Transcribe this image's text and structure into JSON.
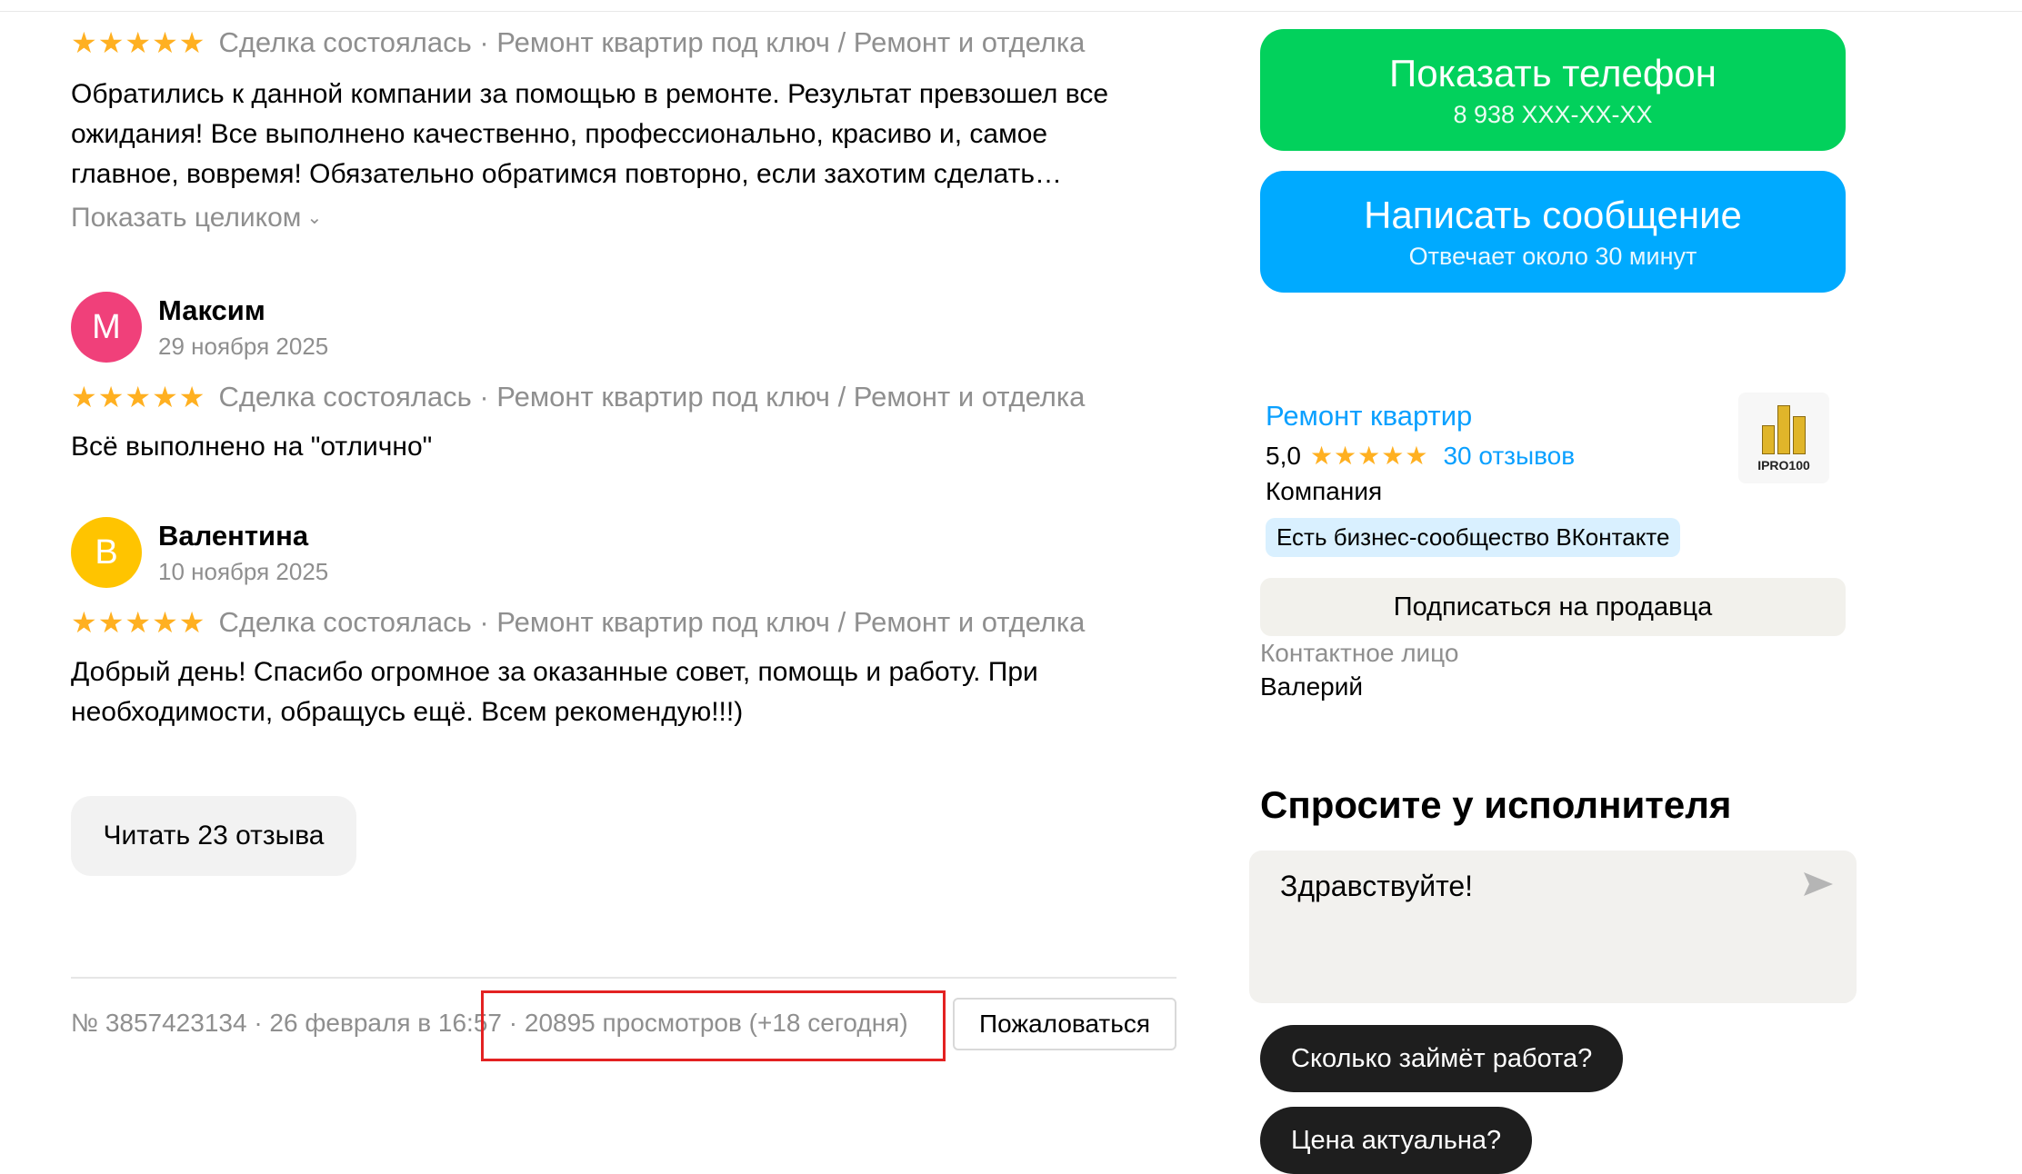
{
  "stars": "★★★★★",
  "reviews": [
    {
      "meta": "Сделка состоялась · Ремонт квартир под ключ / Ремонт и отделка",
      "text": "Обратились к данной компании за помощью в ремонте. Результат превзошел все ожидания! Все выполнено качественно, профессионально, красиво и, самое главное, вовремя! Обязательно обратимся повторно, если захотим сделать…",
      "show_full": "Показать целиком"
    },
    {
      "initial": "М",
      "author": "Максим",
      "date": "29 ноября 2025",
      "meta": "Сделка состоялась · Ремонт квартир под ключ / Ремонт и отделка",
      "text": "Всё выполнено на \"отлично\"",
      "avatar_color": "#f0407a"
    },
    {
      "initial": "В",
      "author": "Валентина",
      "date": "10 ноября 2025",
      "meta": "Сделка состоялась · Ремонт квартир под ключ / Ремонт и отделка",
      "text": "Добрый день! Спасибо огромное за оказанные совет, помощь и работу. При необходимости, обращусь ещё. Всем рекомендую!!!)",
      "avatar_color": "#ffc400"
    }
  ],
  "read_reviews_label": "Читать 23 отзыва",
  "footer": {
    "id_date": "№ 3857423134 · 26 февраля в 16:57",
    "views": " · 20895 просмотров (+18 сегодня)",
    "complain_label": "Пожаловаться"
  },
  "actions": {
    "phone_label": "Показать телефон",
    "phone_number": "8 938 XXX-XX-XX",
    "phone_color": "#02d15c",
    "message_label": "Написать сообщение",
    "message_sub": "Отвечает около 30 минут",
    "message_color": "#00aaff"
  },
  "seller": {
    "name": "Ремонт квартир",
    "rating": "5,0",
    "reviews_link": "30 отзывов",
    "type": "Компания",
    "badge": "Есть бизнес-сообщество ВКонтакте",
    "logo_text": "IPRO100",
    "subscribe_label": "Подписаться на продавца",
    "contact_label": "Контактное лицо",
    "contact_name": "Валерий"
  },
  "ask": {
    "title": "Спросите у исполнителя",
    "input_value": "Здравствуйте!",
    "chips": [
      "Сколько займёт работа?",
      "Цена актуальна?"
    ]
  }
}
